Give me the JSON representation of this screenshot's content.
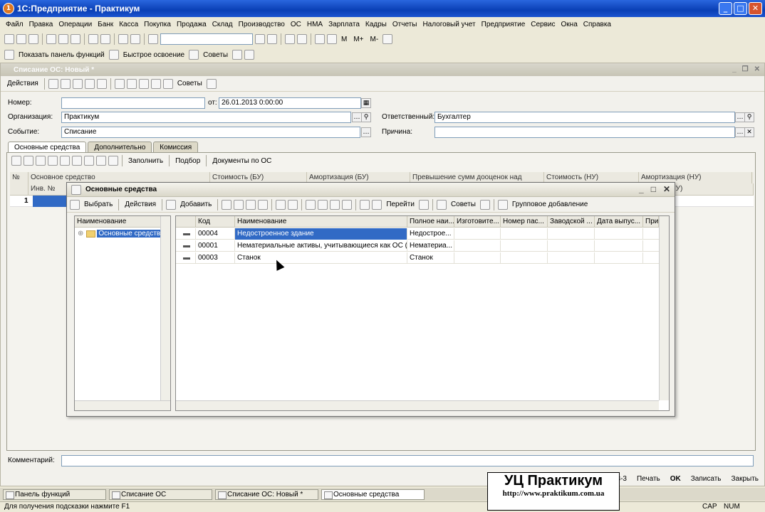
{
  "window": {
    "title": "1С:Предприятие - Практикум"
  },
  "menu": [
    "Файл",
    "Правка",
    "Операции",
    "Банк",
    "Касса",
    "Покупка",
    "Продажа",
    "Склад",
    "Производство",
    "ОС",
    "НМА",
    "Зарплата",
    "Кадры",
    "Отчеты",
    "Налоговый учет",
    "Предприятие",
    "Сервис",
    "Окна",
    "Справка"
  ],
  "toolbar2": {
    "show_panel": "Показать панель функций",
    "quick": "Быстрое освоение",
    "tips": "Советы"
  },
  "doc": {
    "title": "Списание ОС: Новый *",
    "actions": "Действия",
    "tips": "Советы",
    "labels": {
      "number": "Номер:",
      "org": "Организация:",
      "event": "Событие:",
      "date": "от:",
      "responsible": "Ответственный:",
      "reason": "Причина:"
    },
    "values": {
      "number": "",
      "org": "Практикум",
      "event": "Списание",
      "date": "26.01.2013  0:00:00",
      "responsible": "Бухгалтер",
      "reason": ""
    },
    "tabs": [
      "Основные средства",
      "Дополнительно",
      "Комиссия"
    ],
    "tab_toolbar": {
      "fill": "Заполнить",
      "pick": "Подбор",
      "docs": "Документы по ОС"
    },
    "grid_headers": [
      "№",
      "Основное средство",
      "Стоимость (БУ)",
      "Амортизация (БУ)",
      "Превышение сумм дооценок над",
      "Стоимость (НУ)",
      "Амортизация (НУ)"
    ],
    "grid_sub": {
      "inv": "Инв. №",
      "period": "период (НУ)"
    },
    "grid_row_num": "1",
    "comment_label": "Комментарий:",
    "buttons": {
      "n3": "3-3",
      "print": "Печать",
      "ok": "OK",
      "save": "Записать",
      "close": "Закрыть"
    }
  },
  "popup": {
    "title": "Основные средства",
    "toolbar": {
      "select": "Выбрать",
      "actions": "Действия",
      "add": "Добавить",
      "goto": "Перейти",
      "tips": "Советы",
      "group_add": "Групповое добавление"
    },
    "tree_header": "Наименование",
    "tree_item": "Основные средства",
    "list_headers": [
      "Код",
      "Наименование",
      "Полное наи...",
      "Изготовите...",
      "Номер пас...",
      "Заводской ...",
      "Дата выпус...",
      "При"
    ],
    "rows": [
      {
        "code": "00004",
        "name": "Недостроенное здание",
        "full": "Недострое..."
      },
      {
        "code": "00001",
        "name": "Нематериальные активы, учитывающиеся как ОС (...",
        "full": "Нематериа..."
      },
      {
        "code": "00003",
        "name": "Станок",
        "full": "Станок"
      }
    ]
  },
  "taskbar": [
    "Панель функций",
    "Списание ОС",
    "Списание ОС: Новый *",
    "Основные средства"
  ],
  "status": {
    "hint": "Для получения подсказки нажмите F1",
    "cap": "CAP",
    "num": "NUM"
  },
  "watermark": {
    "line1": "УЦ Практикум",
    "line2": "http://www.praktikum.com.ua"
  }
}
